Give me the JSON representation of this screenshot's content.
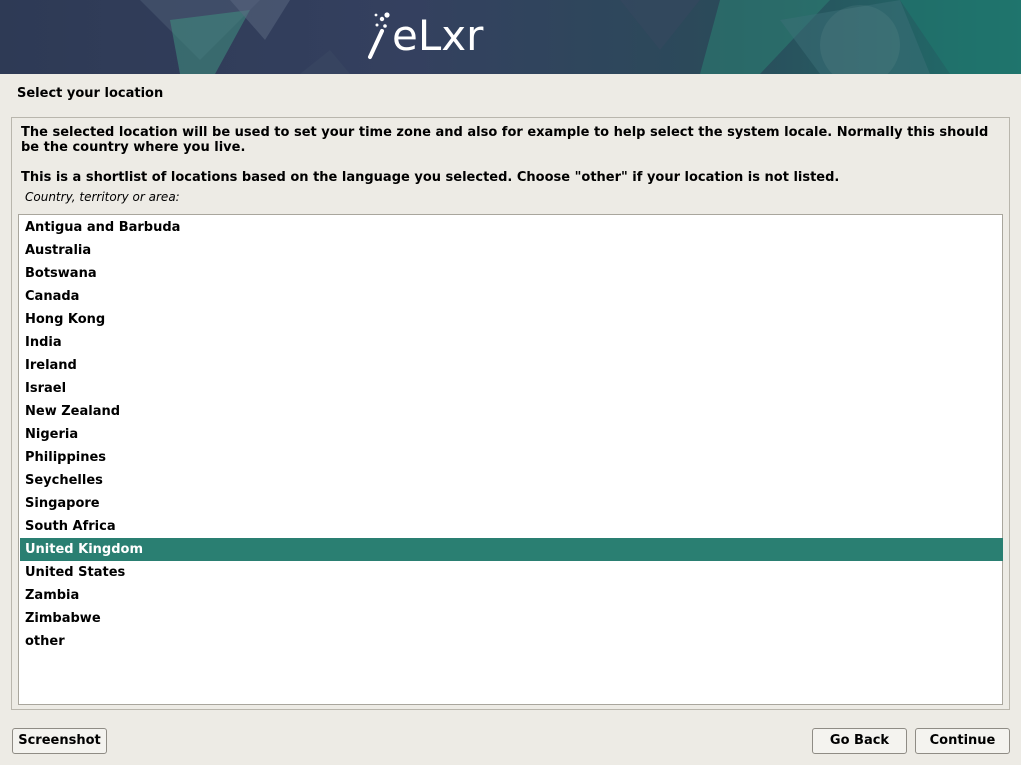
{
  "brand": {
    "name": "eLxr"
  },
  "page": {
    "title": "Select your location",
    "description_1": "The selected location will be used to set your time zone and also for example to help select the system locale. Normally this should be the country where you live.",
    "description_2": "This is a shortlist of locations based on the language you selected. Choose \"other\" if your location is not listed.",
    "field_label": "Country, territory or area:"
  },
  "locations": [
    "Antigua and Barbuda",
    "Australia",
    "Botswana",
    "Canada",
    "Hong Kong",
    "India",
    "Ireland",
    "Israel",
    "New Zealand",
    "Nigeria",
    "Philippines",
    "Seychelles",
    "Singapore",
    "South Africa",
    "United Kingdom",
    "United States",
    "Zambia",
    "Zimbabwe",
    "other"
  ],
  "selected_location": "United Kingdom",
  "buttons": {
    "screenshot": "Screenshot",
    "go_back": "Go Back",
    "continue": "Continue"
  },
  "colors": {
    "selection": "#2a7f72",
    "background": "#edebe5",
    "banner": "#2e3a55"
  }
}
